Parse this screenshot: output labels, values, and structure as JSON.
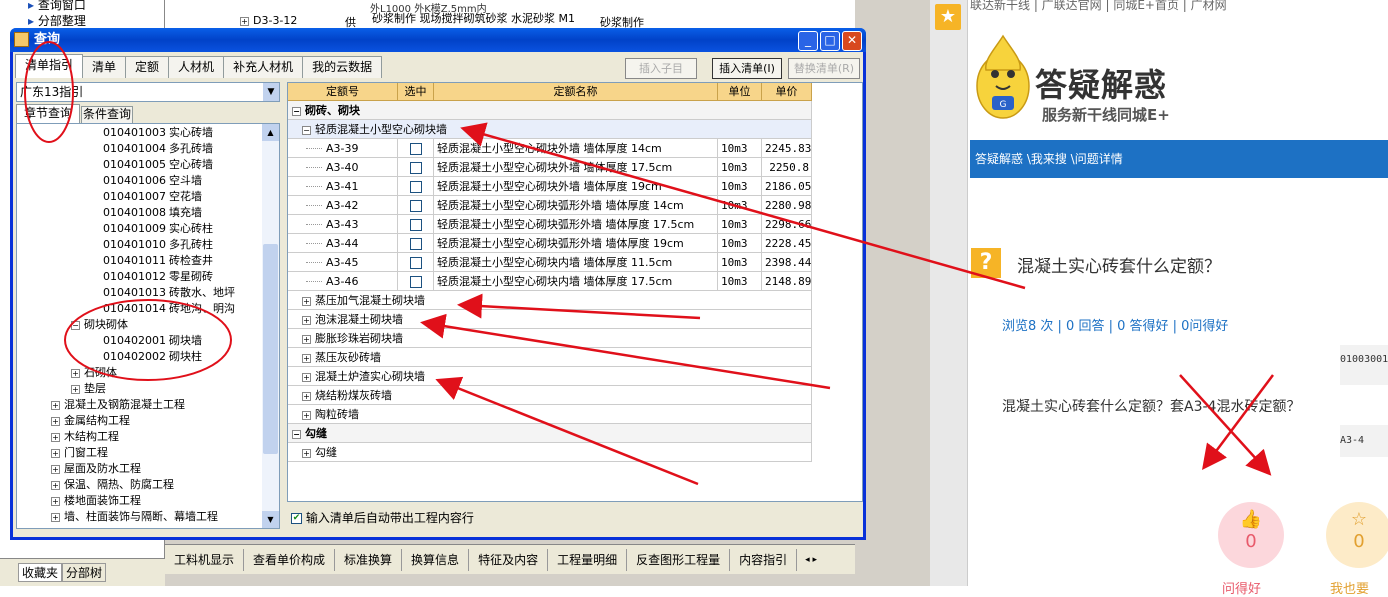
{
  "bg": {
    "side_items": [
      "查询窗口",
      "分部整理"
    ],
    "grid_row_code": "D3-3-12",
    "grid_row_unit": "供",
    "grid_row_name": "砂浆制作 现场搅拌砌筑砂浆 水泥砂浆 M1",
    "grid_row_extra": "砂浆制作",
    "grid_top_text": "外L1000 外K模Z.5mm内",
    "bottom_tabs": [
      "工料机显示",
      "查看单价构成",
      "标准换算",
      "换算信息",
      "特征及内容",
      "工程量明细",
      "反查图形工程量",
      "内容指引"
    ],
    "side_tabs": [
      "收藏夹",
      "分部树"
    ]
  },
  "dialog": {
    "title": "查询",
    "tabs": [
      "清单指引",
      "清单",
      "定额",
      "人材机",
      "补充人材机",
      "我的云数据"
    ],
    "buttons": {
      "insert_child": "插入子目",
      "insert_list": "插入清单(I)",
      "replace_list": "替换清单(R)"
    },
    "combo_value": "广东13指引",
    "subtabs": [
      "章节查询",
      "条件查询"
    ],
    "tree": [
      {
        "code": "010401003",
        "name": "实心砖墙"
      },
      {
        "code": "010401004",
        "name": "多孔砖墙"
      },
      {
        "code": "010401005",
        "name": "空心砖墙"
      },
      {
        "code": "010401006",
        "name": "空斗墙"
      },
      {
        "code": "010401007",
        "name": "空花墙"
      },
      {
        "code": "010401008",
        "name": "填充墙"
      },
      {
        "code": "010401009",
        "name": "实心砖柱"
      },
      {
        "code": "010401010",
        "name": "多孔砖柱"
      },
      {
        "code": "010401011",
        "name": "砖检查井"
      },
      {
        "code": "010401012",
        "name": "零星砌砖"
      },
      {
        "code": "010401013",
        "name": "砖散水、地坪"
      },
      {
        "code": "010401014",
        "name": "砖地沟、明沟"
      }
    ],
    "tree_group": "砌块砌体",
    "tree_group_items": [
      {
        "code": "010402001",
        "name": "砌块墙"
      },
      {
        "code": "010402002",
        "name": "砌块柱"
      }
    ],
    "tree_more": [
      "石砌体",
      "垫层"
    ],
    "tree_top": [
      "混凝土及钢筋混凝土工程",
      "金属结构工程",
      "木结构工程",
      "门窗工程",
      "屋面及防水工程",
      "保温、隔热、防腐工程",
      "楼地面装饰工程",
      "墙、柱面装饰与隔断、幕墙工程"
    ],
    "grid_headers": [
      "定额号",
      "选中",
      "定额名称",
      "单位",
      "单价"
    ],
    "grid_section1": "砌砖、砌块",
    "grid_sub1": "轻质混凝土小型空心砌块墙",
    "grid_rows": [
      {
        "code": "A3-39",
        "name": "轻质混凝土小型空心砌块外墙 墙体厚度 14cm",
        "unit": "10m3",
        "price": "2245.83"
      },
      {
        "code": "A3-40",
        "name": "轻质混凝土小型空心砌块外墙 墙体厚度 17.5cm",
        "unit": "10m3",
        "price": "2250.8"
      },
      {
        "code": "A3-41",
        "name": "轻质混凝土小型空心砌块外墙 墙体厚度 19cm",
        "unit": "10m3",
        "price": "2186.05"
      },
      {
        "code": "A3-42",
        "name": "轻质混凝土小型空心砌块弧形外墙 墙体厚度 14cm",
        "unit": "10m3",
        "price": "2280.98"
      },
      {
        "code": "A3-43",
        "name": "轻质混凝土小型空心砌块弧形外墙 墙体厚度 17.5cm",
        "unit": "10m3",
        "price": "2298.66"
      },
      {
        "code": "A3-44",
        "name": "轻质混凝土小型空心砌块弧形外墙 墙体厚度 19cm",
        "unit": "10m3",
        "price": "2228.45"
      },
      {
        "code": "A3-45",
        "name": "轻质混凝土小型空心砌块内墙 墙体厚度 11.5cm",
        "unit": "10m3",
        "price": "2398.44"
      },
      {
        "code": "A3-46",
        "name": "轻质混凝土小型空心砌块内墙 墙体厚度 17.5cm",
        "unit": "10m3",
        "price": "2148.89"
      }
    ],
    "grid_subs": [
      "蒸压加气混凝土砌块墙",
      "泡沫混凝土砌块墙",
      "膨胀珍珠岩砌块墙",
      "蒸压灰砂砖墙",
      "混凝土炉渣实心砌块墙",
      "烧结粉煤灰砖墙",
      "陶粒砖墙"
    ],
    "grid_section2": "勾缝",
    "grid_sub_last": "勾缝",
    "auto_check_label": "输入清单后自动带出工程内容行"
  },
  "web": {
    "topnav": "联达新干线 | 广联达官网 | 同城E+首页 | 广材网",
    "logo_title": "答疑解惑",
    "logo_sub": "服务新干线同城E+",
    "breadcrumb": "答疑解惑 \\我来搜 \\问题详情",
    "question_title": "混凝土实心砖套什么定额？",
    "stats": "浏览8 次 | 0 回答 | 0 答得好 | 0问得好",
    "question_body": "混凝土实心砖套什么定额？套A3-4混水砖定额？",
    "snip1": "01003001",
    "snip2": "A3-4",
    "like_count": "0",
    "fav_count": "0",
    "like_label": "问得好",
    "fav_label": "我也要"
  },
  "colors": {
    "accent_red": "#e0101a",
    "blue_bar": "#1d71c4",
    "header_orange": "#f7d58a"
  },
  "icons": [
    "star-icon",
    "question-icon",
    "thumbs-up-icon",
    "star-outline-icon",
    "minimize-icon",
    "maximize-icon",
    "close-icon"
  ]
}
